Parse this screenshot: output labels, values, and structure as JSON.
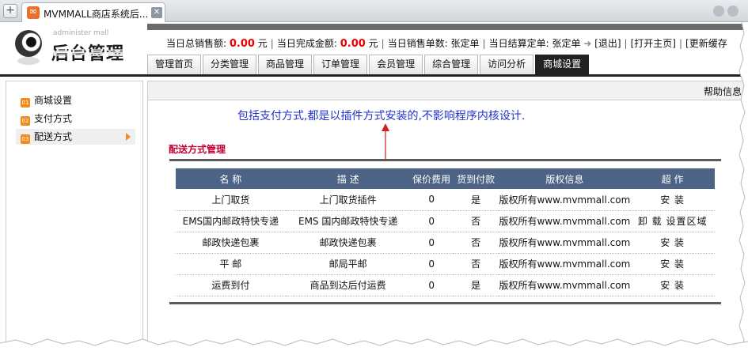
{
  "browser": {
    "new_tab_symbol": "+",
    "tab_title": "MVMMALL商店系统后...",
    "close_symbol": "✕"
  },
  "header": {
    "logo_sub": "administer mall",
    "logo_title": "后台管理",
    "stats": {
      "total_sales_label": "当日总销售额:",
      "total_sales_value": "0.00",
      "total_sales_unit": "元",
      "completed_label": "当日完成金额:",
      "completed_value": "0.00",
      "completed_unit": "元",
      "orders_count": "当日销售单数: 张定单",
      "settled_count": "当日结算定单: 张定单",
      "logout": "[退出]",
      "open_home": "[打开主页]",
      "refresh_cache": "[更新缓存"
    },
    "nav_tabs": [
      "管理首页",
      "分类管理",
      "商品管理",
      "订单管理",
      "会员管理",
      "综合管理",
      "访问分析",
      "商城设置"
    ],
    "active_tab": "商城设置"
  },
  "sidebar": {
    "items": [
      {
        "badge": "01",
        "label": "商城设置"
      },
      {
        "badge": "02",
        "label": "支付方式"
      },
      {
        "badge": "03",
        "label": "配送方式"
      }
    ]
  },
  "content": {
    "help_link": "帮助信息",
    "annotation": "包括支付方式,都是以插件方式安装的,不影响程序内核设计.",
    "section_title": "配送方式管理",
    "table": {
      "headers": [
        "名 称",
        "描 述",
        "保价费用",
        "货到付款",
        "版权信息",
        "超 作"
      ],
      "rows": [
        {
          "name": "上门取货",
          "desc": "上门取货插件",
          "fee": "0",
          "cod": "是",
          "copyright": "版权所有www.mvmmall.com",
          "action": "安 装"
        },
        {
          "name": "EMS国内邮政特快专递",
          "desc": "EMS 国内邮政特快专递",
          "fee": "0",
          "cod": "否",
          "copyright": "版权所有www.mvmmall.com",
          "action": "卸 载 设置区域"
        },
        {
          "name": "邮政快递包裹",
          "desc": "邮政快递包裹",
          "fee": "0",
          "cod": "否",
          "copyright": "版权所有www.mvmmall.com",
          "action": "安 装"
        },
        {
          "name": "平 邮",
          "desc": "邮局平邮",
          "fee": "0",
          "cod": "否",
          "copyright": "版权所有www.mvmmall.com",
          "action": "安 装"
        },
        {
          "name": "运费到付",
          "desc": "商品到达后付运费",
          "fee": "0",
          "cod": "是",
          "copyright": "版权所有www.mvmmall.com",
          "action": "安 装"
        }
      ]
    }
  },
  "colors": {
    "table_header_bg": "#4d6487",
    "accent_orange": "#f08c1c",
    "section_title": "#c00030",
    "annotation": "#2233cc",
    "stat_value": "#ee0000"
  }
}
